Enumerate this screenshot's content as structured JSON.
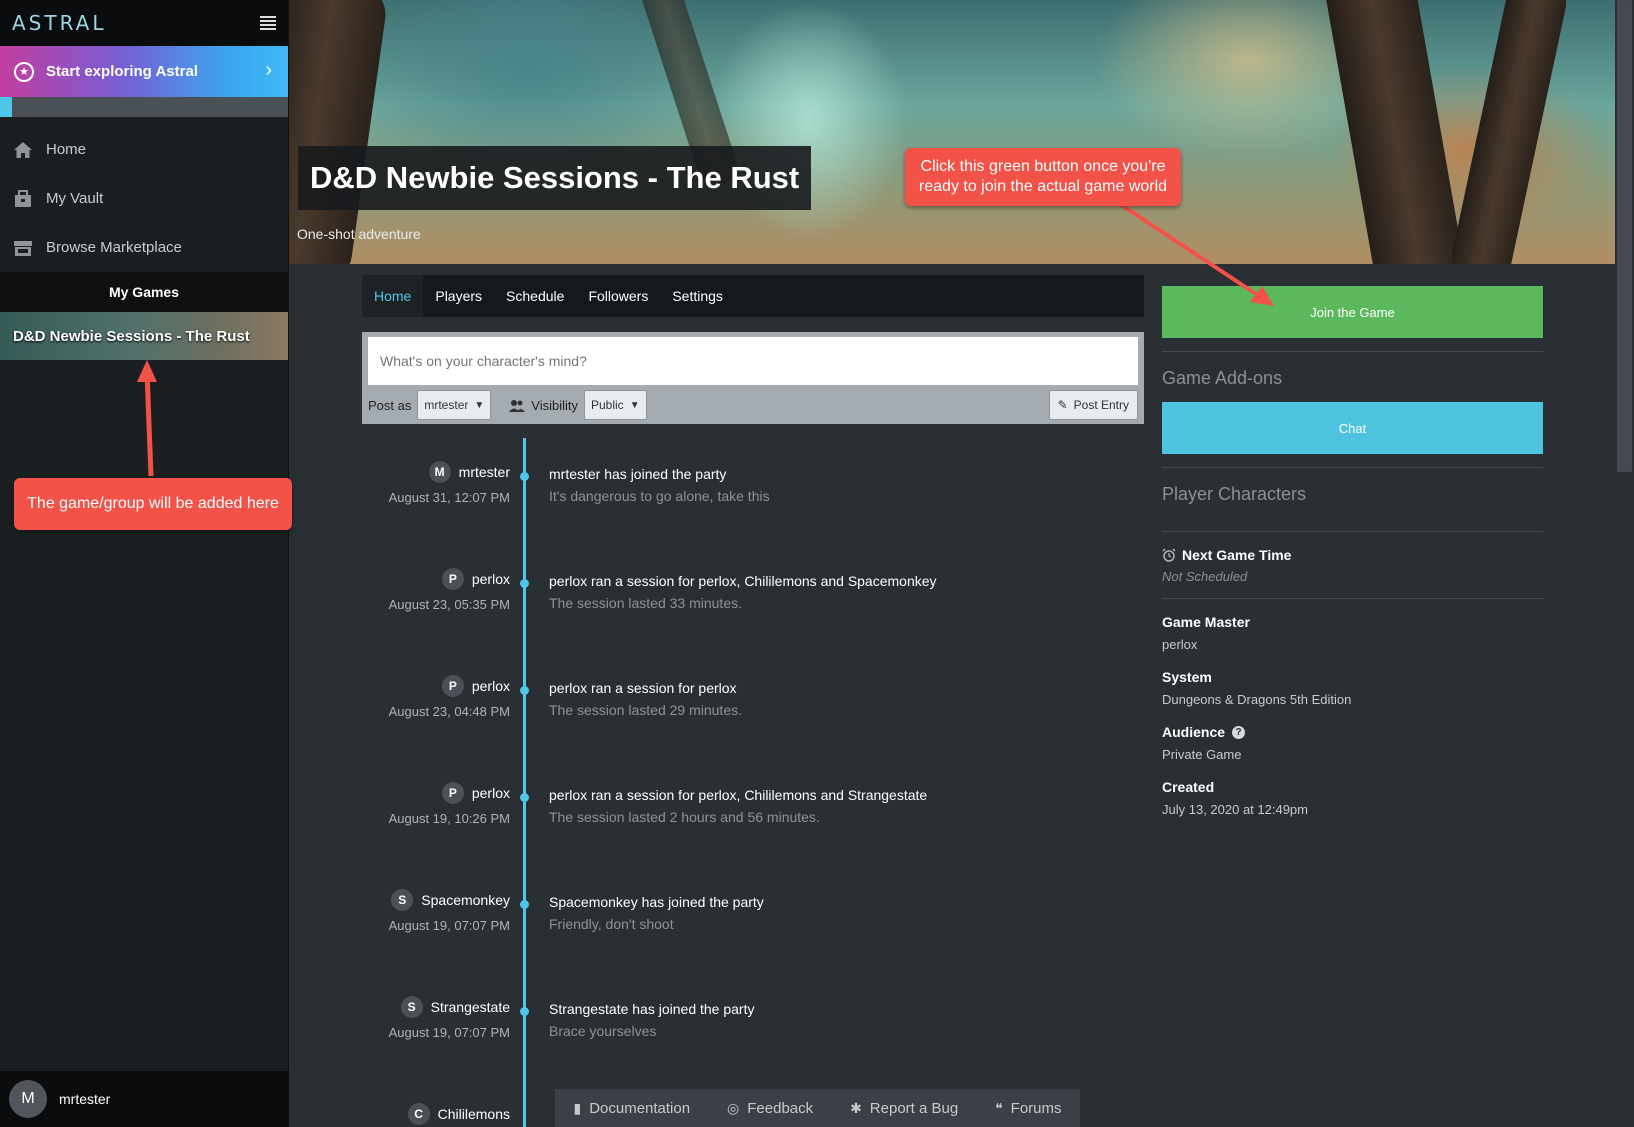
{
  "app": {
    "logo": "ASTRAL"
  },
  "sidebar": {
    "explore_label": "Start exploring Astral",
    "explore_progress": 0.04,
    "nav": [
      {
        "label": "Home",
        "icon": "home-icon"
      },
      {
        "label": "My Vault",
        "icon": "vault-icon"
      },
      {
        "label": "Browse Marketplace",
        "icon": "marketplace-icon"
      }
    ],
    "my_games_label": "My Games",
    "games": [
      {
        "label": "D&D Newbie Sessions - The Rust"
      }
    ],
    "user": {
      "initial": "M",
      "name": "mrtester"
    }
  },
  "banner": {
    "title": "D&D Newbie Sessions - The Rust",
    "subtitle": "One-shot adventure"
  },
  "tabs": [
    {
      "label": "Home",
      "active": true
    },
    {
      "label": "Players",
      "active": false
    },
    {
      "label": "Schedule",
      "active": false
    },
    {
      "label": "Followers",
      "active": false
    },
    {
      "label": "Settings",
      "active": false
    }
  ],
  "composer": {
    "placeholder": "What's on your character's mind?",
    "post_as_label": "Post as",
    "post_as_value": "mrtester",
    "visibility_label": "Visibility",
    "visibility_value": "Public",
    "post_button": "Post Entry"
  },
  "timeline": [
    {
      "initial": "M",
      "user": "mrtester",
      "date": "August 31, 12:07 PM",
      "title": "mrtester has joined the party",
      "detail": "It's dangerous to go alone, take this"
    },
    {
      "initial": "P",
      "user": "perlox",
      "date": "August 23, 05:35 PM",
      "title": "perlox ran a session for perlox, Chililemons and Spacemonkey",
      "detail": "The session lasted 33 minutes."
    },
    {
      "initial": "P",
      "user": "perlox",
      "date": "August 23, 04:48 PM",
      "title": "perlox ran a session for perlox",
      "detail": "The session lasted 29 minutes."
    },
    {
      "initial": "P",
      "user": "perlox",
      "date": "August 19, 10:26 PM",
      "title": "perlox ran a session for perlox, Chililemons and Strangestate",
      "detail": "The session lasted 2 hours and 56 minutes."
    },
    {
      "initial": "S",
      "user": "Spacemonkey",
      "date": "August 19, 07:07 PM",
      "title": "Spacemonkey has joined the party",
      "detail": "Friendly, don't shoot"
    },
    {
      "initial": "S",
      "user": "Strangestate",
      "date": "August 19, 07:07 PM",
      "title": "Strangestate has joined the party",
      "detail": "Brace yourselves"
    },
    {
      "initial": "C",
      "user": "Chililemons",
      "date": "",
      "title": "",
      "detail": ""
    }
  ],
  "right_panel": {
    "join_button": "Join the Game",
    "addons_head": "Game Add-ons",
    "chat_button": "Chat",
    "pc_head": "Player Characters",
    "next_game_label": "Next Game Time",
    "next_game_value": "Not Scheduled",
    "gm_label": "Game Master",
    "gm_value": "perlox",
    "system_label": "System",
    "system_value": "Dungeons & Dragons 5th Edition",
    "audience_label": "Audience",
    "audience_value": "Private Game",
    "created_label": "Created",
    "created_value": "July 13, 2020 at 12:49pm"
  },
  "footer": [
    {
      "label": "Documentation",
      "icon": "book-icon"
    },
    {
      "label": "Feedback",
      "icon": "feedback-icon"
    },
    {
      "label": "Report a Bug",
      "icon": "bug-icon"
    },
    {
      "label": "Forums",
      "icon": "forums-icon"
    }
  ],
  "annotations": {
    "sidebar_note": "The game/group will be added here",
    "join_note": "Click this green button once you're ready to join the actual game world"
  },
  "colors": {
    "accent": "#4fc7ea",
    "join_green": "#5cb85c",
    "chat_blue": "#4dc3e0",
    "callout_red": "#f25247"
  }
}
